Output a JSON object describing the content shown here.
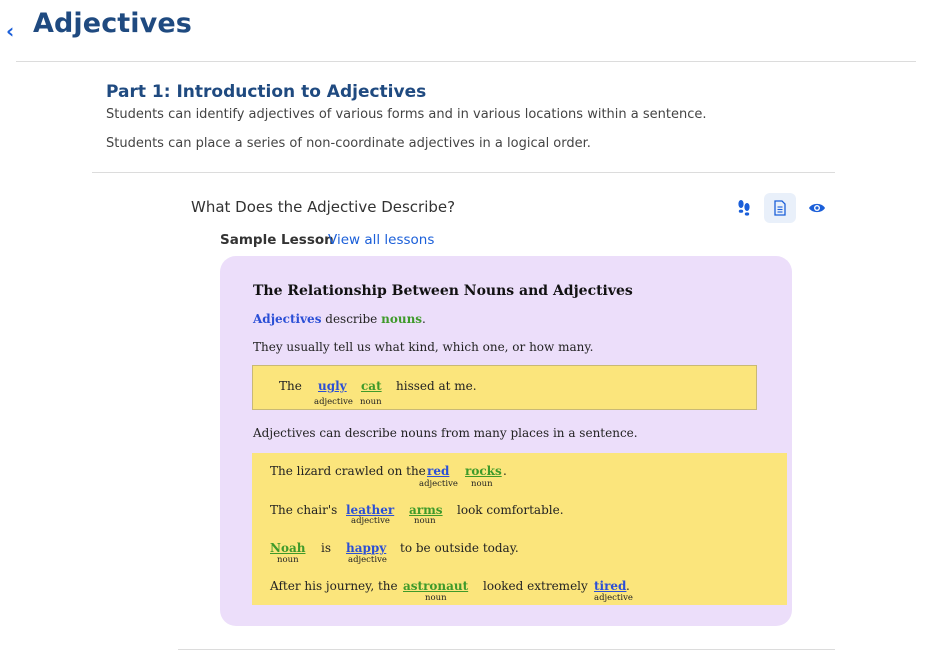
{
  "header": {
    "title": "Adjectives"
  },
  "part": {
    "title": "Part 1: Introduction to Adjectives",
    "objectives": [
      "Students can identify adjectives of various forms and in various locations within a sentence.",
      "Students can place a series of non-coordinate adjectives in a logical order."
    ]
  },
  "lesson": {
    "title": "What Does the Adjective Describe?",
    "actions": [
      "footprints-icon",
      "document-icon",
      "eye-icon"
    ],
    "sample_label": "Sample Lesson",
    "view_all": "View all lessons"
  },
  "card": {
    "title": "The Relationship Between Nouns and Adjectives",
    "line1": {
      "a": "Adjectives",
      "b": " describe ",
      "c": "nouns",
      "d": "."
    },
    "line2": "They usually tell us what kind, which one, or how many.",
    "line3": "Adjectives can describe nouns from many places in a sentence.",
    "example": {
      "the": "The",
      "adj": "ugly",
      "noun": "cat",
      "rest": "hissed at me.",
      "adj_label": "adjective",
      "noun_label": "noun"
    },
    "sentences": {
      "s1": {
        "a": "The lizard crawled on the",
        "adj": "red",
        "noun": "rocks",
        "end": ".",
        "adj_label": "adjective",
        "noun_label": "noun"
      },
      "s2": {
        "a": "The chair's",
        "adj": "leather",
        "noun": "arms",
        "end": "look comfortable.",
        "adj_label": "adjective",
        "noun_label": "noun"
      },
      "s3": {
        "noun": "Noah",
        "mid": "is",
        "adj": "happy",
        "end": "to be outside today.",
        "noun_label": "noun",
        "adj_label": "adjective"
      },
      "s4": {
        "a": "After his journey, the",
        "noun": "astronaut",
        "mid": "looked extremely",
        "adj": "tired",
        "end": ".",
        "noun_label": "noun",
        "adj_label": "adjective"
      }
    }
  },
  "colors": {
    "title_blue": "#1f4a80",
    "link_blue": "#1b5fd9",
    "card_bg": "#ecdefa",
    "highlight": "#fbe57c",
    "adjective": "#2b4fd6",
    "noun": "#3e9a2a"
  }
}
